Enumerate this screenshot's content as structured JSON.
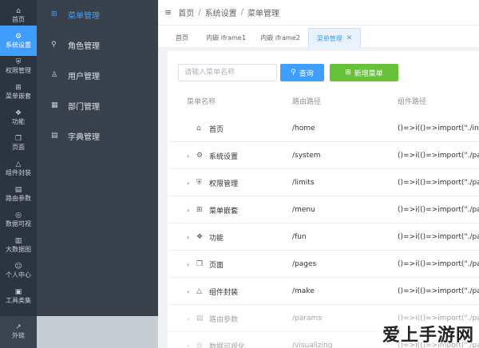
{
  "rail": {
    "items": [
      {
        "label": "首页",
        "icon": "⌂"
      },
      {
        "label": "系统设置",
        "icon": "⚙"
      },
      {
        "label": "权限管理",
        "icon": "⛨"
      },
      {
        "label": "菜单嵌套",
        "icon": "⊞"
      },
      {
        "label": "功能",
        "icon": "❖"
      },
      {
        "label": "页面",
        "icon": "❐"
      },
      {
        "label": "组件封装",
        "icon": "△"
      },
      {
        "label": "路由参数",
        "icon": "▤"
      },
      {
        "label": "数据可视",
        "icon": "◎"
      },
      {
        "label": "大数据图",
        "icon": "▥"
      },
      {
        "label": "个人中心",
        "icon": "☺"
      },
      {
        "label": "工具类集",
        "icon": "▣"
      },
      {
        "label": "外链",
        "icon": "↗"
      }
    ],
    "active_index": 1
  },
  "submenu": {
    "items": [
      {
        "label": "菜单管理",
        "icon": "⊞"
      },
      {
        "label": "角色管理",
        "icon": "⚲"
      },
      {
        "label": "用户管理",
        "icon": "♙"
      },
      {
        "label": "部门管理",
        "icon": "▦"
      },
      {
        "label": "字典管理",
        "icon": "▤"
      }
    ]
  },
  "header": {
    "menu_icon": "≡",
    "breadcrumb": [
      "首页",
      "系统设置",
      "菜单管理"
    ],
    "separator": "/"
  },
  "tabs": [
    {
      "label": "首页"
    },
    {
      "label": "内嵌 iframe1"
    },
    {
      "label": "内嵌 iframe2"
    },
    {
      "label": "菜单管理",
      "close": "✕"
    }
  ],
  "toolbar": {
    "search_placeholder": "请输入菜单名称",
    "query_label": "查询",
    "query_icon": "⚲",
    "add_label": "新增菜单",
    "add_icon": "⊞"
  },
  "table": {
    "headers": [
      "菜单名称",
      "路由路径",
      "组件路径"
    ],
    "rows": [
      {
        "expand": "",
        "icon": "⌂",
        "name": "首页",
        "path": "/home",
        "component": "()=>i(()=>import(\"./inde..."
      },
      {
        "expand": "›",
        "icon": "⚙",
        "name": "系统设置",
        "path": "/system",
        "component": "()=>i(()=>import(\"./pare..."
      },
      {
        "expand": "›",
        "icon": "⛨",
        "name": "权限管理",
        "path": "/limits",
        "component": "()=>i(()=>import(\"./pare..."
      },
      {
        "expand": "›",
        "icon": "⊞",
        "name": "菜单嵌套",
        "path": "/menu",
        "component": "()=>i(()=>import(\"./pare..."
      },
      {
        "expand": "›",
        "icon": "❖",
        "name": "功能",
        "path": "/fun",
        "component": "()=>i(()=>import(\"./pare..."
      },
      {
        "expand": "›",
        "icon": "❐",
        "name": "页面",
        "path": "/pages",
        "component": "()=>i(()=>import(\"./pare..."
      },
      {
        "expand": "›",
        "icon": "△",
        "name": "组件封装",
        "path": "/make",
        "component": "()=>i(()=>import(\"./pare..."
      },
      {
        "expand": "›",
        "icon": "▤",
        "name": "路由参数",
        "path": "/params",
        "component": "()=>i(()=>import(\"./pare..."
      },
      {
        "expand": "›",
        "icon": "◎",
        "name": "数据可视化",
        "path": "/visualizing",
        "component": "()=>i(()=>import(\"./pare..."
      }
    ]
  },
  "watermark": {
    "brand": "爱上手游网"
  },
  "colors": {
    "primary": "#409eff",
    "success": "#67c23a",
    "rail_bg": "#2c3440",
    "submenu_bg": "#39414c"
  }
}
